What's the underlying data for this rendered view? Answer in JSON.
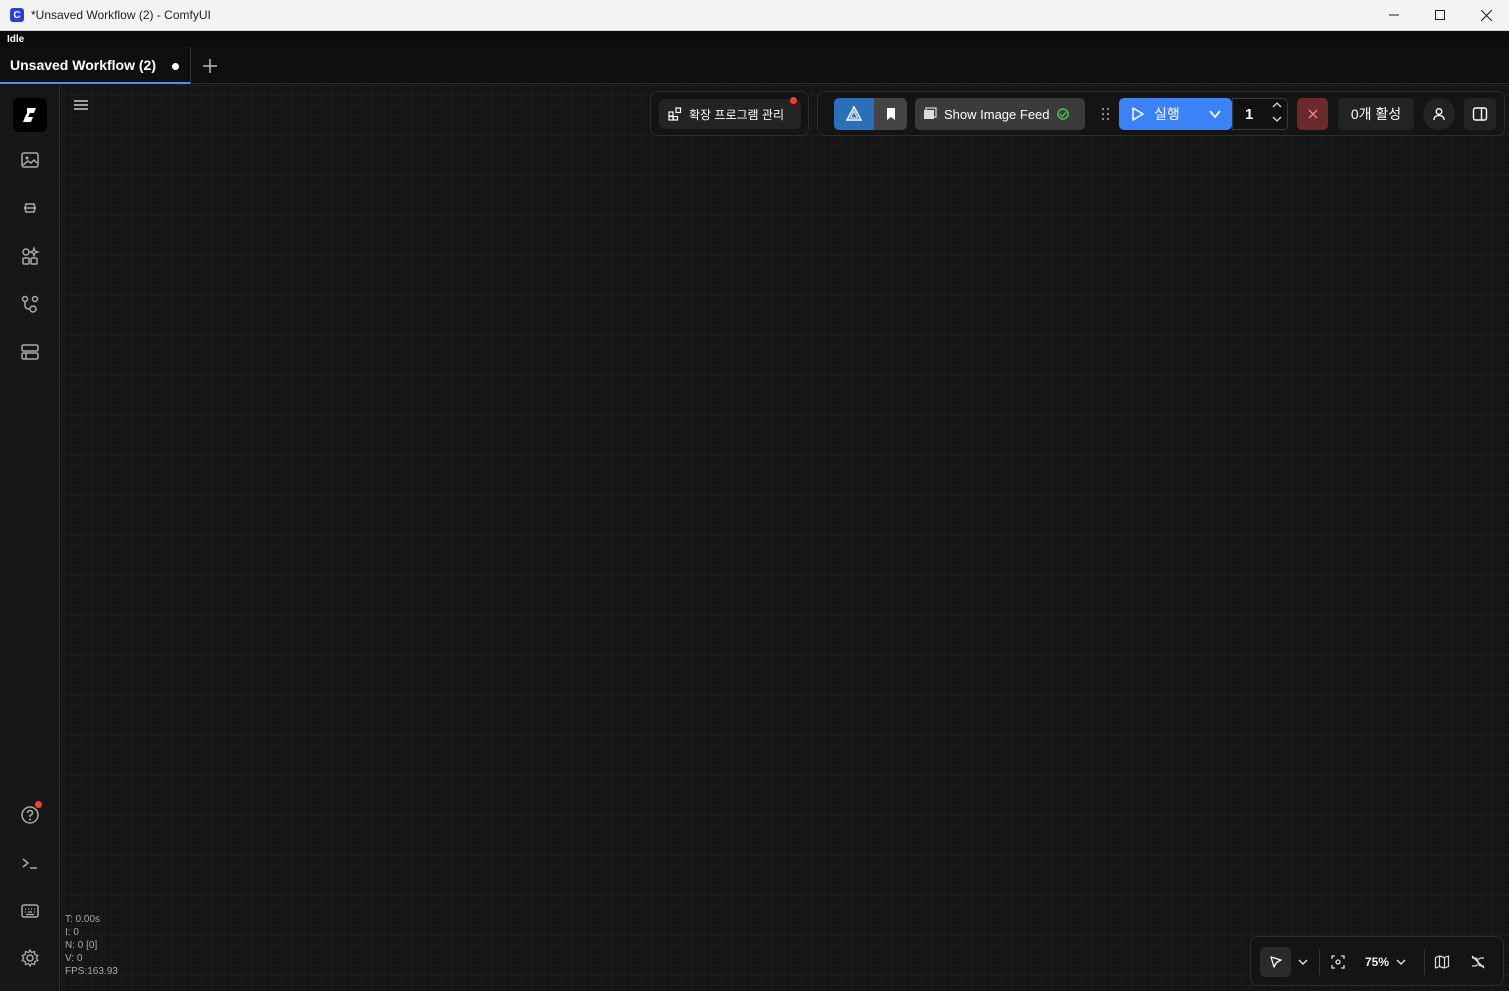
{
  "window": {
    "title": "*Unsaved Workflow (2) - ComfyUI",
    "app_icon_letter": "C"
  },
  "status": {
    "text": "Idle"
  },
  "tabs": [
    {
      "label": "Unsaved Workflow (2)",
      "unsaved": true,
      "active": true
    }
  ],
  "toolbar": {
    "extensions_label": "확장 프로그램 관리",
    "image_feed_label": "Show Image Feed",
    "run_label": "실행",
    "queue_count": "1",
    "active_label": "0개 활성"
  },
  "stats": {
    "t": "T: 0.00s",
    "i": "I: 0",
    "n": "N: 0 [0]",
    "v": "V: 0",
    "fps": "FPS:163.93"
  },
  "zoom": {
    "label": "75%"
  },
  "colors": {
    "accent": "#3b82f6",
    "notification": "#ff3b30",
    "stop": "#6b2a2a"
  }
}
